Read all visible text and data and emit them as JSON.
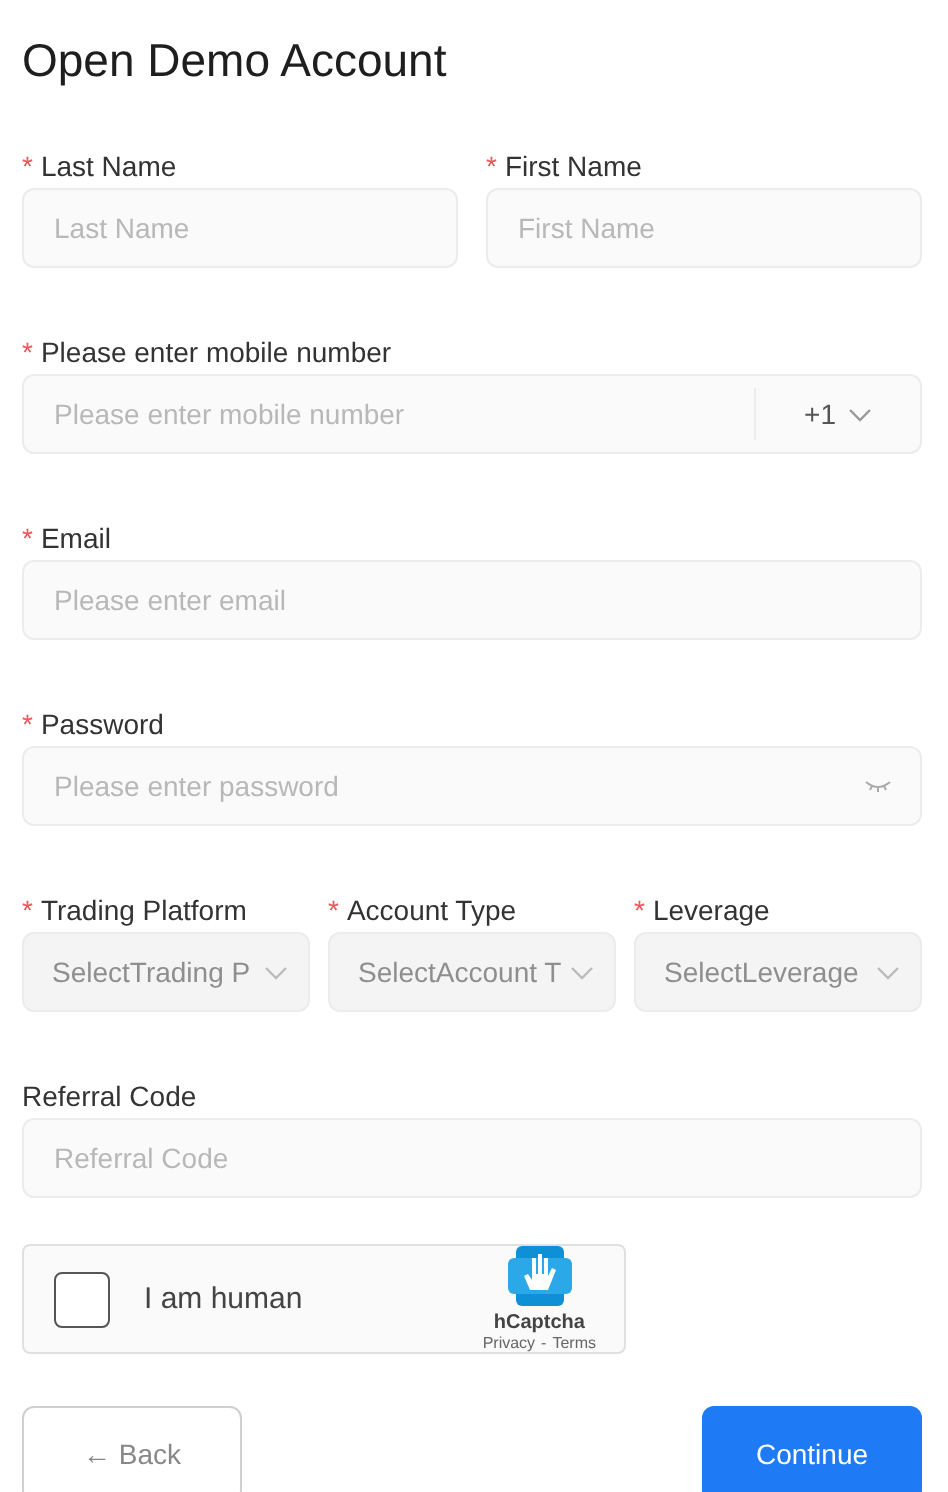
{
  "title": "Open Demo Account",
  "name_row": [
    {
      "marker": "*",
      "label": "Last Name",
      "placeholder": "Last Name"
    },
    {
      "marker": "*",
      "label": "First Name",
      "placeholder": "First Name"
    }
  ],
  "phone": {
    "marker": "*",
    "label": "Please enter mobile number",
    "placeholder": "Please enter mobile number",
    "code": "+1"
  },
  "email": {
    "marker": "*",
    "label": "Email",
    "placeholder": "Please enter email"
  },
  "password": {
    "marker": "*",
    "label": "Password",
    "placeholder": "Please enter password"
  },
  "select_row": [
    {
      "marker": "*",
      "label": "Trading Platform",
      "placeholder": "SelectTrading P",
      "disabled": true
    },
    {
      "marker": "*",
      "label": "Account Type",
      "placeholder": "SelectAccount T",
      "disabled": true
    },
    {
      "marker": "*",
      "label": "Leverage",
      "placeholder": "SelectLeverage",
      "disabled": true
    }
  ],
  "referral": {
    "label": "Referral Code",
    "placeholder": "Referral Code"
  },
  "captcha": {
    "checked": false,
    "label": "I am human",
    "brand": "hCaptcha",
    "privacy": "Privacy",
    "separator": "-",
    "terms": "Terms"
  },
  "buttons": [
    {
      "kind": "secondary",
      "label": "← Back"
    },
    {
      "kind": "primary",
      "label": "Continue"
    }
  ]
}
